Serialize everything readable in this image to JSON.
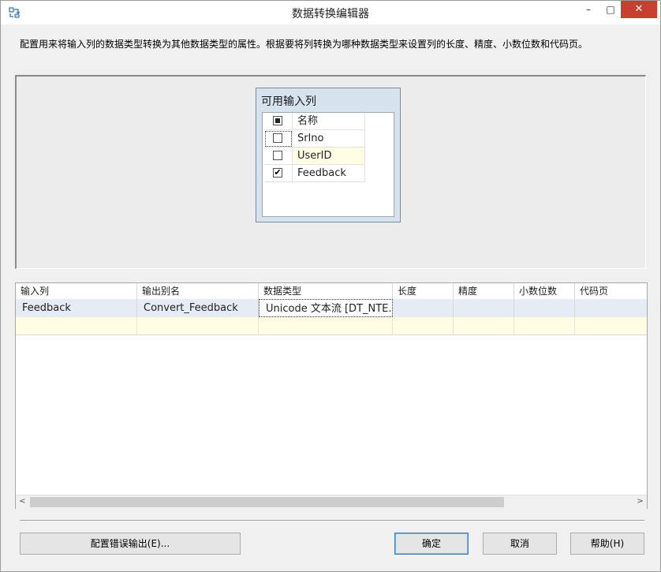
{
  "window": {
    "title": "数据转换编辑器"
  },
  "title_buttons": {
    "minimize": "–",
    "maximize": "□",
    "close": "✕"
  },
  "description": "配置用来将输入列的数据类型转换为其他数据类型的属性。根据要将列转换为哪种数据类型来设置列的长度、精度、小数位数和代码页。",
  "available_columns": {
    "title": "可用输入列",
    "header_label": "名称",
    "items": [
      {
        "name": "Srlno",
        "checked": false
      },
      {
        "name": "UserID",
        "checked": false
      },
      {
        "name": "Feedback",
        "checked": true
      }
    ]
  },
  "grid": {
    "columns": [
      "输入列",
      "输出别名",
      "数据类型",
      "长度",
      "精度",
      "小数位数",
      "代码页"
    ],
    "rows": [
      [
        "Feedback",
        "Convert_Feedback",
        "Unicode 文本流 [DT_NTE...",
        "",
        "",
        "",
        ""
      ]
    ]
  },
  "scrollbar": {
    "left_arrow": "<",
    "right_arrow": ">"
  },
  "buttons": {
    "config_error": "配置错误输出(E)...",
    "ok": "确定",
    "cancel": "取消",
    "help": "帮助(H)"
  },
  "checkmark": "✔"
}
